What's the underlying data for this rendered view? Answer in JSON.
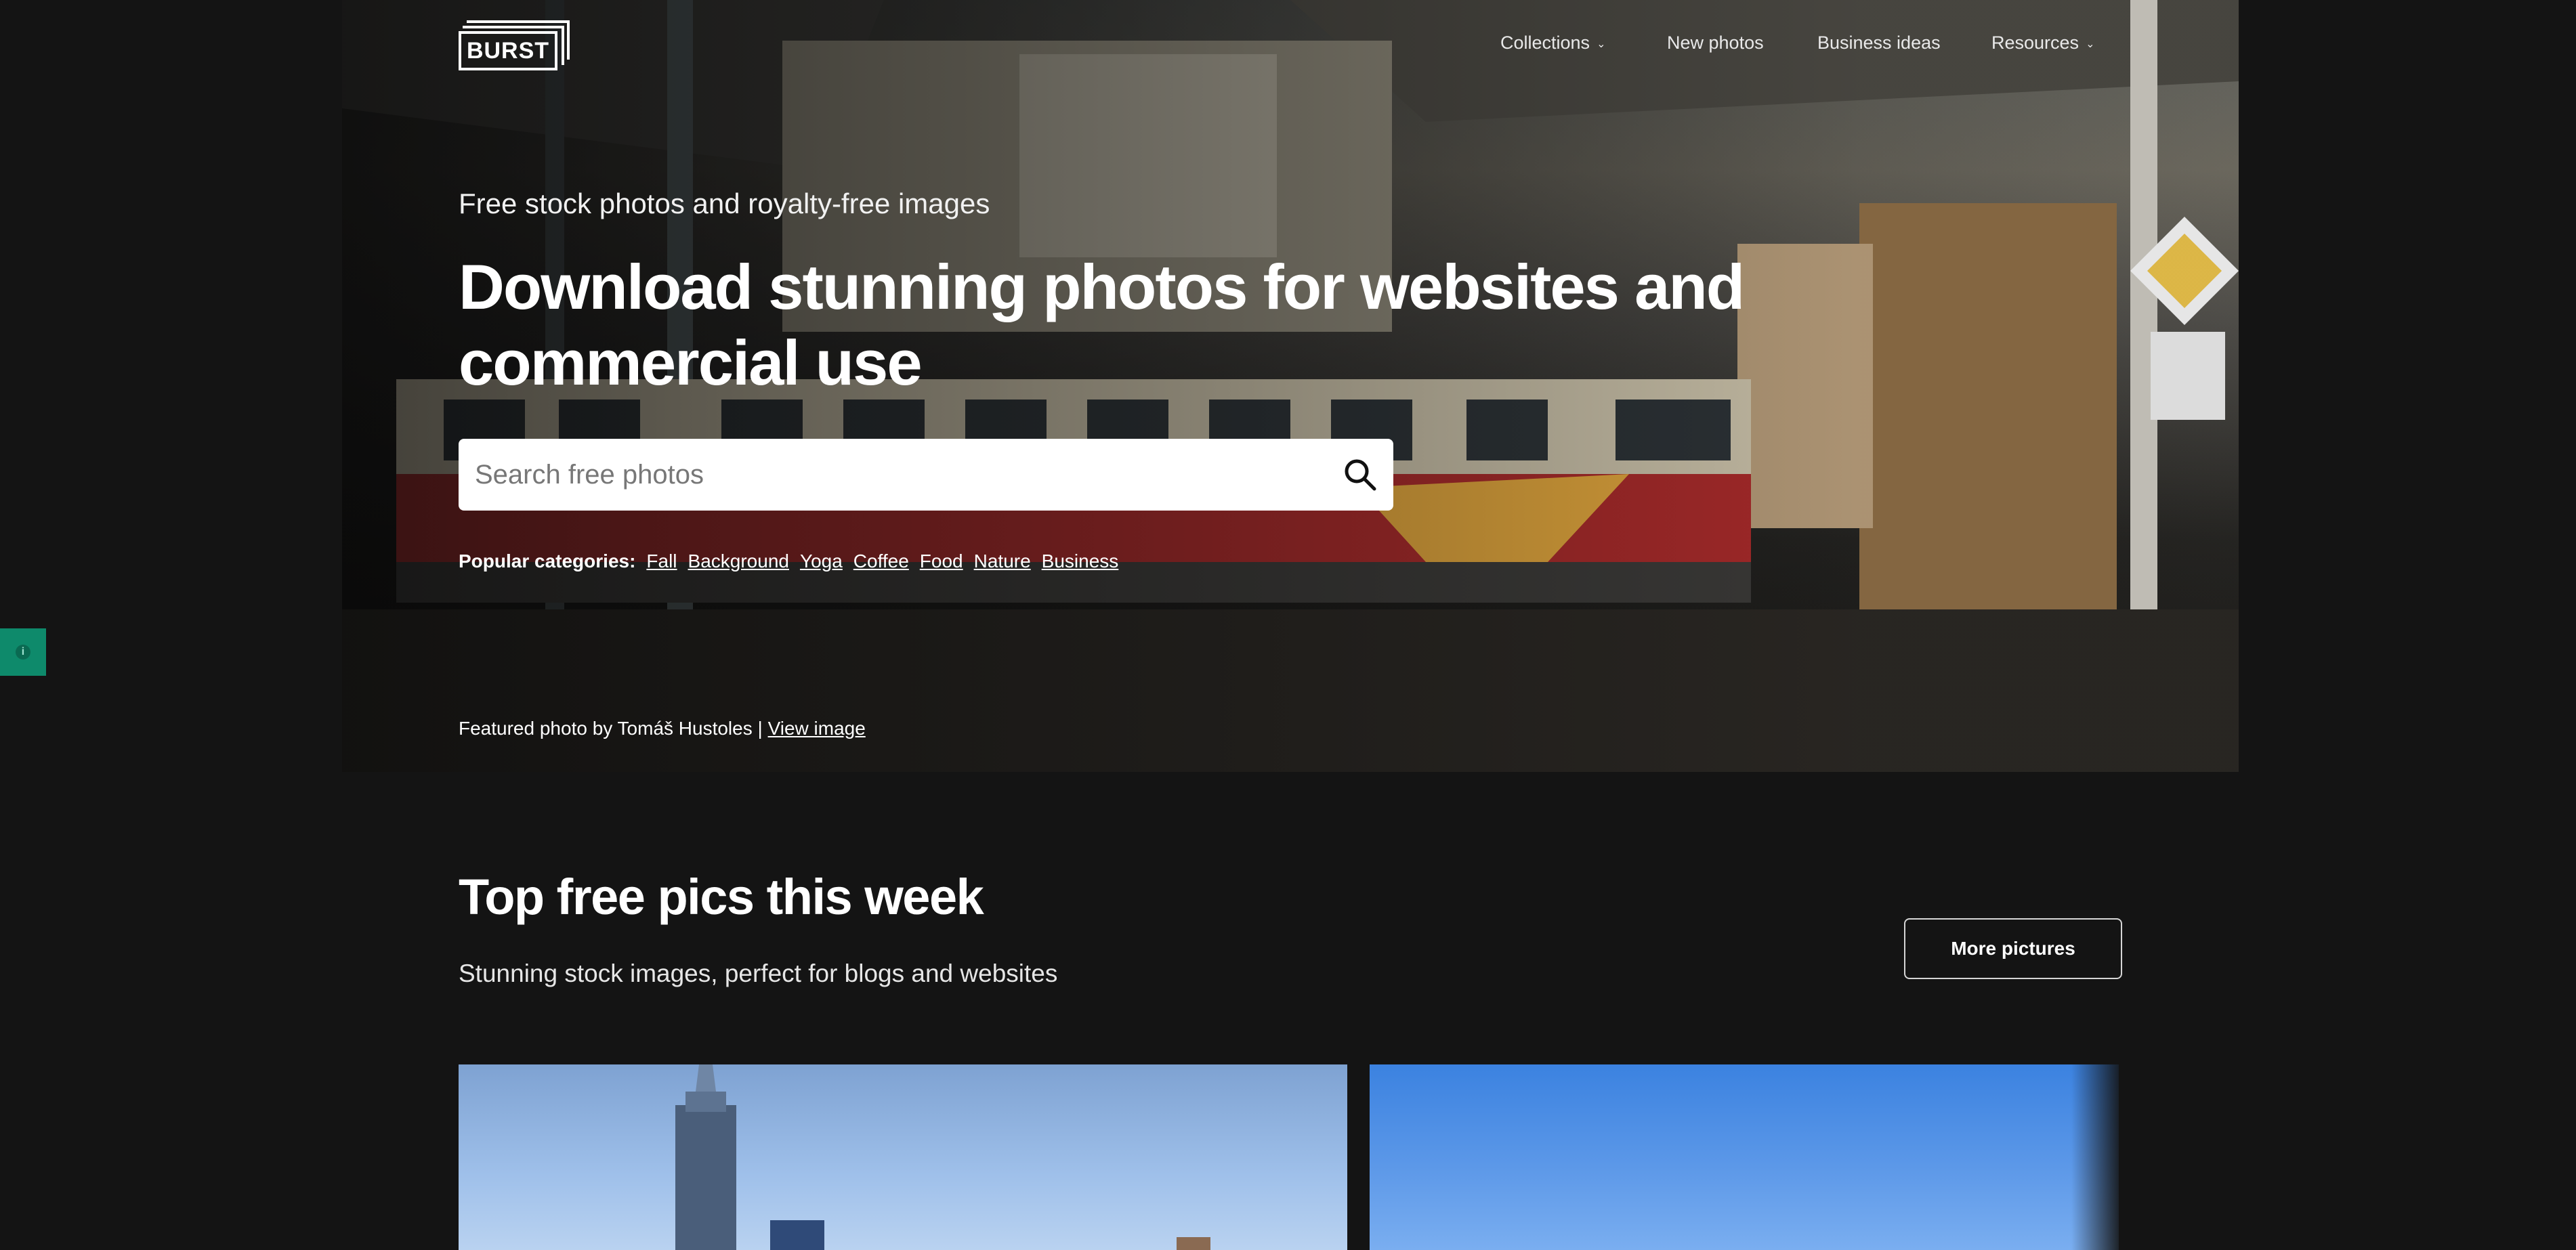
{
  "brand": {
    "logo_text": "BURST"
  },
  "nav": {
    "items": [
      {
        "label": "Collections",
        "has_dropdown": true
      },
      {
        "label": "New photos",
        "has_dropdown": false
      },
      {
        "label": "Business ideas",
        "has_dropdown": false
      },
      {
        "label": "Resources",
        "has_dropdown": true
      }
    ]
  },
  "hero": {
    "subtitle": "Free stock photos and royalty-free images",
    "title": "Download stunning photos for websites and commercial use",
    "search_placeholder": "Search free photos",
    "categories_label": "Popular categories:",
    "categories": [
      "Fall",
      "Background",
      "Yoga",
      "Coffee",
      "Food",
      "Nature",
      "Business"
    ],
    "credit_text": "Featured photo by Tomáš Hustoles |",
    "credit_link": "View image"
  },
  "section": {
    "title": "Top free pics this week",
    "subtitle": "Stunning stock images, perfect for blogs and websites",
    "more_button": "More pictures"
  },
  "colors": {
    "page_bg": "#141414",
    "badge": "#0e8a6b",
    "search_bg": "#ffffff"
  },
  "icons": [
    "info-icon",
    "search-icon",
    "chevron-down-icon"
  ]
}
